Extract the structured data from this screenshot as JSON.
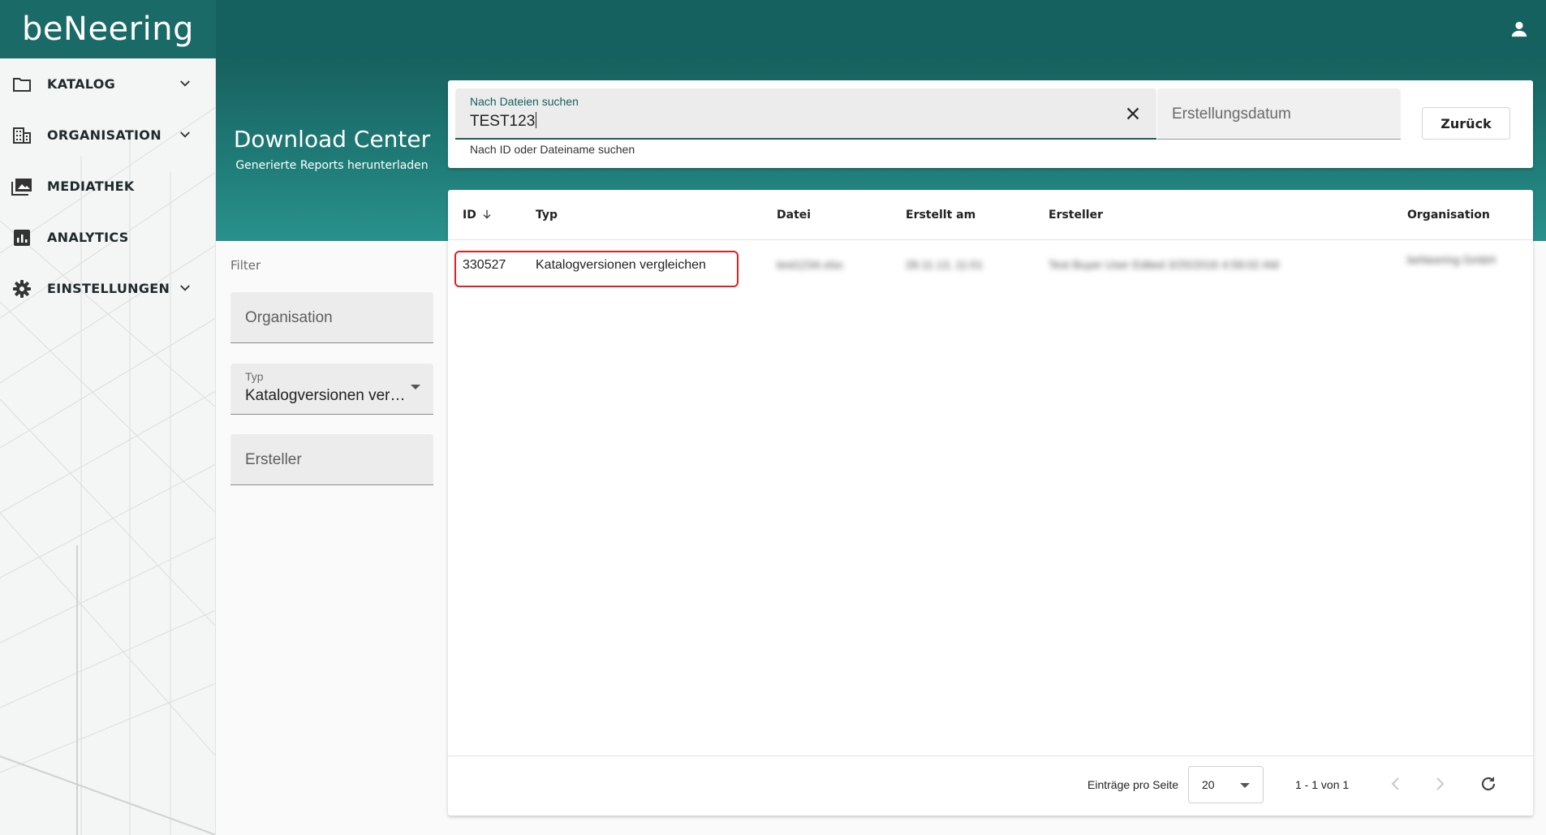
{
  "app": {
    "logo_text": "beNeering"
  },
  "sidebar": {
    "items": [
      {
        "label": "KATALOG",
        "icon": "folder-icon",
        "has_children": true
      },
      {
        "label": "ORGANISATION",
        "icon": "building-icon",
        "has_children": true
      },
      {
        "label": "MEDIATHEK",
        "icon": "media-library-icon",
        "has_children": false
      },
      {
        "label": "ANALYTICS",
        "icon": "analytics-icon",
        "has_children": false
      },
      {
        "label": "EINSTELLUNGEN",
        "icon": "gear-icon",
        "has_children": true
      }
    ]
  },
  "header": {
    "title": "Download Center",
    "subtitle": "Generierte Reports herunterladen"
  },
  "search": {
    "label": "Nach Dateien suchen",
    "value": "TEST123",
    "hint": "Nach ID oder Dateiname suchen",
    "date_placeholder": "Erstellungsdatum",
    "back_label": "Zurück"
  },
  "filter": {
    "title": "Filter",
    "organisation_placeholder": "Organisation",
    "type_label": "Typ",
    "type_value": "Katalogversionen vergleichen",
    "creator_placeholder": "Ersteller"
  },
  "table": {
    "columns": [
      "ID",
      "Typ",
      "Datei",
      "Erstellt am",
      "Ersteller",
      "Organisation"
    ],
    "sort_column": "ID",
    "sort_direction": "descending",
    "rows": [
      {
        "id": "330527",
        "type": "Katalogversionen vergleichen",
        "file": "test1234.xlsx",
        "created": "28.11.13, 11:01",
        "creator": "Test Buyer User Edited 3/25/2016 4:58:02 AM",
        "organisation": "beNeering GmbH",
        "redacted": true
      }
    ]
  },
  "pagination": {
    "per_page_label": "Einträge pro Seite",
    "per_page_value": "20",
    "range_label": "1 - 1 von 1"
  },
  "colors": {
    "primary": "#15615f",
    "highlight": "#e02020"
  }
}
